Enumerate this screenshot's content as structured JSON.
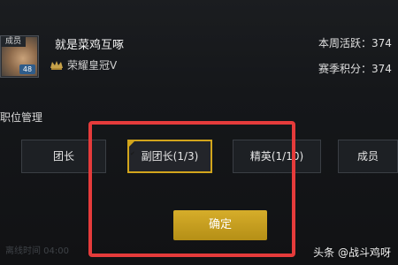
{
  "profile": {
    "role_tag": "成员",
    "level": "48",
    "name": "就是菜鸡互啄",
    "rank": "荣耀皇冠Ⅴ"
  },
  "stats": {
    "weekly_activity": "本周活跃：374",
    "season_points": "赛季积分：374"
  },
  "section": {
    "title": "职位管理"
  },
  "positions": [
    {
      "label": "团长",
      "selected": false
    },
    {
      "label": "副团长(1/3)",
      "selected": true
    },
    {
      "label": "精英(1/10)",
      "selected": false
    },
    {
      "label": "成员",
      "selected": false
    }
  ],
  "confirm_label": "确定",
  "footer": {
    "left_text": "离线时间 04:00"
  },
  "watermark": "头条 @战斗鸡呀",
  "colors": {
    "accent": "#d2a51c",
    "annotation": "#e53b3b"
  }
}
